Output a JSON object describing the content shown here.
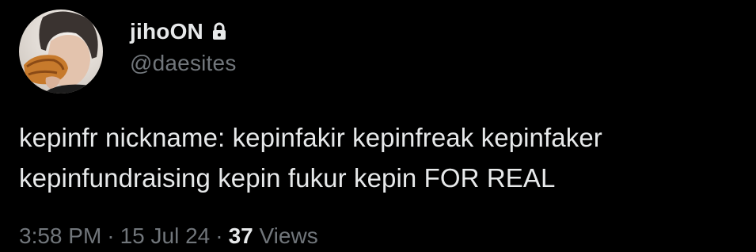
{
  "author": {
    "display_name": "jihoON",
    "handle": "@daesites",
    "avatar_icon": "user-avatar",
    "protected_icon": "lock-icon"
  },
  "tweet": {
    "line1": "kepinfr nickname: kepinfakir kepinfreak kepinfaker",
    "line2": "kepinfundraising kepin fukur kepin FOR REAL"
  },
  "meta": {
    "time": "3:58 PM",
    "separator": "·",
    "date": "15 Jul 24",
    "views_count": "37",
    "views_label": "Views"
  },
  "colors": {
    "background": "#000000",
    "primary_text": "#e7e9ea",
    "secondary_text": "#71767b"
  }
}
